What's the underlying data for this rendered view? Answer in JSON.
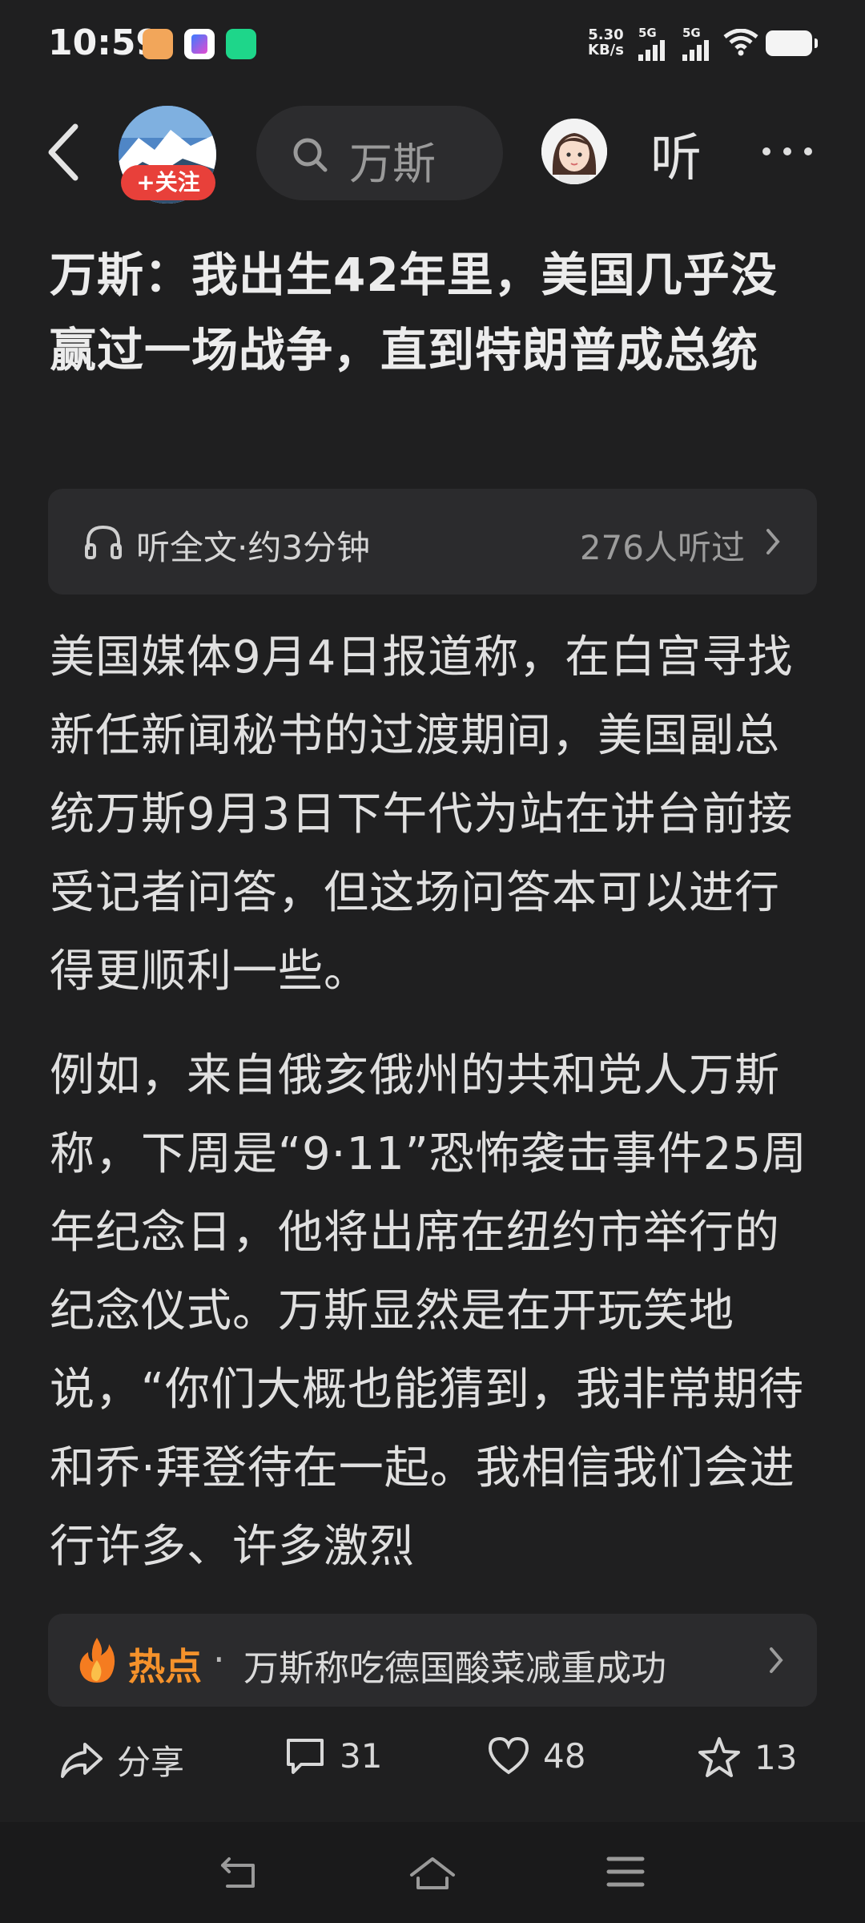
{
  "status_bar": {
    "time": "10:59",
    "net_speed_value": "5.30",
    "net_speed_unit": "KB/s",
    "signal_1_label": "5G",
    "signal_2_label": "5G"
  },
  "nav": {
    "follow_label": "+关注",
    "search_text": "万斯",
    "listen_label": "听"
  },
  "article": {
    "title": "万斯：我出生42年里，美国几乎没赢过一场战争，直到特朗普成总统",
    "listen_bar": {
      "label": "听全文·约3分钟",
      "count": "276人听过"
    },
    "paragraphs": [
      "美国媒体9月4日报道称，在白宫寻找新任新闻秘书的过渡期间，美国副总统万斯9月3日下午代为站在讲台前接受记者问答，但这场问答本可以进行得更顺利一些。",
      "例如，来自俄亥俄州的共和党人万斯称，下周是“9·11”恐怖袭击事件25周年纪念日，他将出席在纽约市举行的纪念仪式。万斯显然是在开玩笑地说，“你们大概也能猜到，我非常期待和乔·拜登待在一起。我相信我们会进行许多、许多激烈"
    ]
  },
  "hot": {
    "label": "热点",
    "separator": "·",
    "text": "万斯称吃德国酸菜减重成功"
  },
  "actions": {
    "share_label": "分享",
    "comment_count": "31",
    "like_count": "48",
    "favorite_count": "13"
  },
  "colors": {
    "background": "#1f1f20",
    "card": "#2b2b2d",
    "follow_red": "#e8403a",
    "hot_orange": "#f5922b"
  },
  "icons": [
    "back-icon",
    "search-icon",
    "headphones-icon",
    "chevron-right-icon",
    "flame-icon",
    "share-icon",
    "comment-icon",
    "heart-icon",
    "star-icon",
    "nav-back-icon",
    "nav-home-icon",
    "nav-menu-icon"
  ]
}
